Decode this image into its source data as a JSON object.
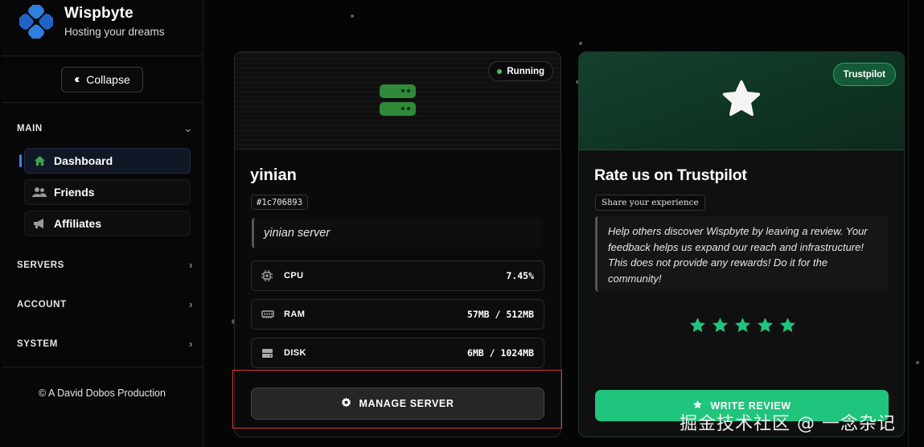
{
  "brand": {
    "name": "Wispbyte",
    "tagline": "Hosting your dreams"
  },
  "sidebar": {
    "collapse_label": "Collapse",
    "sections": {
      "main": "MAIN",
      "servers": "SERVERS",
      "account": "ACCOUNT",
      "system": "SYSTEM"
    },
    "items": [
      {
        "label": "Dashboard",
        "icon": "home-icon",
        "active": true
      },
      {
        "label": "Friends",
        "icon": "users-icon",
        "active": false
      },
      {
        "label": "Affiliates",
        "icon": "megaphone-icon",
        "active": false
      }
    ],
    "footer": "© A David Dobos Production"
  },
  "server": {
    "status": "Running",
    "name": "yinian",
    "id": "#1c706893",
    "description": "yinian server",
    "stats": [
      {
        "label": "CPU",
        "value": "7.45%"
      },
      {
        "label": "RAM",
        "value": "57MB / 512MB"
      },
      {
        "label": "DISK",
        "value": "6MB / 1024MB"
      }
    ],
    "manage_label": "MANAGE SERVER"
  },
  "trustpilot": {
    "badge": "Trustpilot",
    "title": "Rate us on Trustpilot",
    "subtitle": "Share your experience",
    "description": "Help others discover Wispbyte by leaving a review. Your feedback helps us expand our reach and infrastructure! This does not provide any rewards! Do it for the community!",
    "stars": 5,
    "review_label": "WRITE REVIEW"
  },
  "watermark": "掘金技术社区 @ 一念杂记",
  "colors": {
    "accent_green": "#1fc47d",
    "status_green": "#3ec46d",
    "active_blue": "#3b82f6",
    "highlight_red": "#d9382f"
  }
}
